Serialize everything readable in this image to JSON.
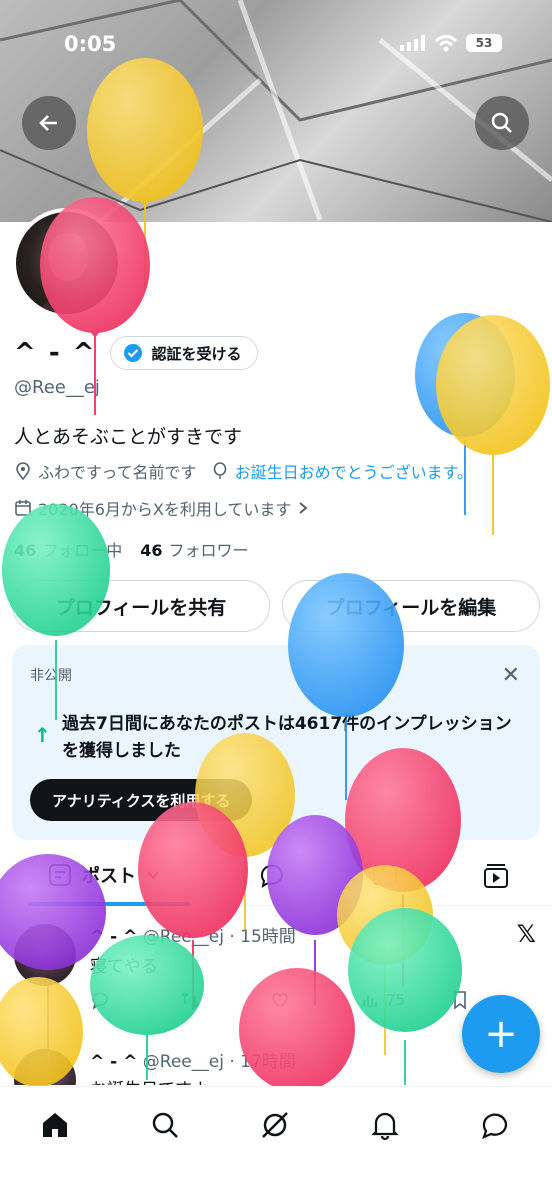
{
  "status_bar": {
    "time": "0:05",
    "battery": "53"
  },
  "profile": {
    "display_name": "^ - ^",
    "verify_label": "認証を受ける",
    "handle": "@Ree__ej",
    "bio": "人とあそぶことがすきです",
    "location": "ふわですって名前です",
    "birthday_text": "お誕生日おめでとうございます。",
    "joined": "2020年6月からXを利用しています",
    "following_count": "46",
    "following_label": "フォロー中",
    "followers_count": "46",
    "followers_label": "フォロワー"
  },
  "buttons": {
    "share": "プロフィールを共有",
    "edit": "プロフィールを編集"
  },
  "private_card": {
    "label": "非公開",
    "message": "過去7日間にあなたのポストは4617件のインプレッションを獲得しました",
    "analytics_button": "アナリティクスを利用する"
  },
  "tabs": [
    {
      "label": "ポスト"
    }
  ],
  "posts": [
    {
      "name": "^ - ^",
      "handle": "@Ree__ej",
      "time": "15時間",
      "text": "寝てやる",
      "views": "75"
    },
    {
      "name": "^ - ^",
      "handle": "@Ree__ej",
      "time": "17時間",
      "text": "お誕生日ですよー"
    }
  ],
  "colors": {
    "accent": "#1d9bf0",
    "green": "#00ba7c",
    "balloon_yellow": "#f5c518",
    "balloon_pink": "#f0386b",
    "balloon_blue": "#2f9bf5",
    "balloon_green": "#27d69b",
    "balloon_purple": "#9b3be0"
  }
}
